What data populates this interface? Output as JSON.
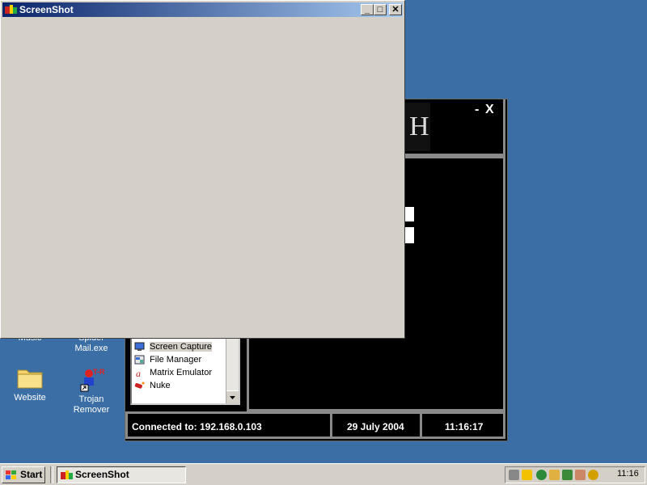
{
  "screenshot_window": {
    "title": "ScreenShot",
    "minimize": "_",
    "maximize": "□",
    "close": "✕"
  },
  "remote_app": {
    "minimize": "-",
    "close": "X",
    "banner_glyph": "H",
    "menu_items": [
      "Screen Capture",
      "File Manager",
      "Matrix Emulator",
      "Nuke"
    ],
    "selected_item": "Screen Capture",
    "status": {
      "connection": "Connected to: 192.168.0.103",
      "date": "29 July 2004",
      "time": "11:16:17"
    }
  },
  "desktop_icons": [
    {
      "label": "Music"
    },
    {
      "label": "Spider Mail.exe"
    },
    {
      "label": "Website"
    },
    {
      "label": "Trojan Remover"
    }
  ],
  "taskbar": {
    "start_label": "Start",
    "task_label": "ScreenShot",
    "clock": "11:16"
  },
  "colors": {
    "desktop": "#3a6ea5",
    "titlebar_start": "#0a246a",
    "titlebar_end": "#a6caf0",
    "window_face": "#d4d0c8"
  }
}
